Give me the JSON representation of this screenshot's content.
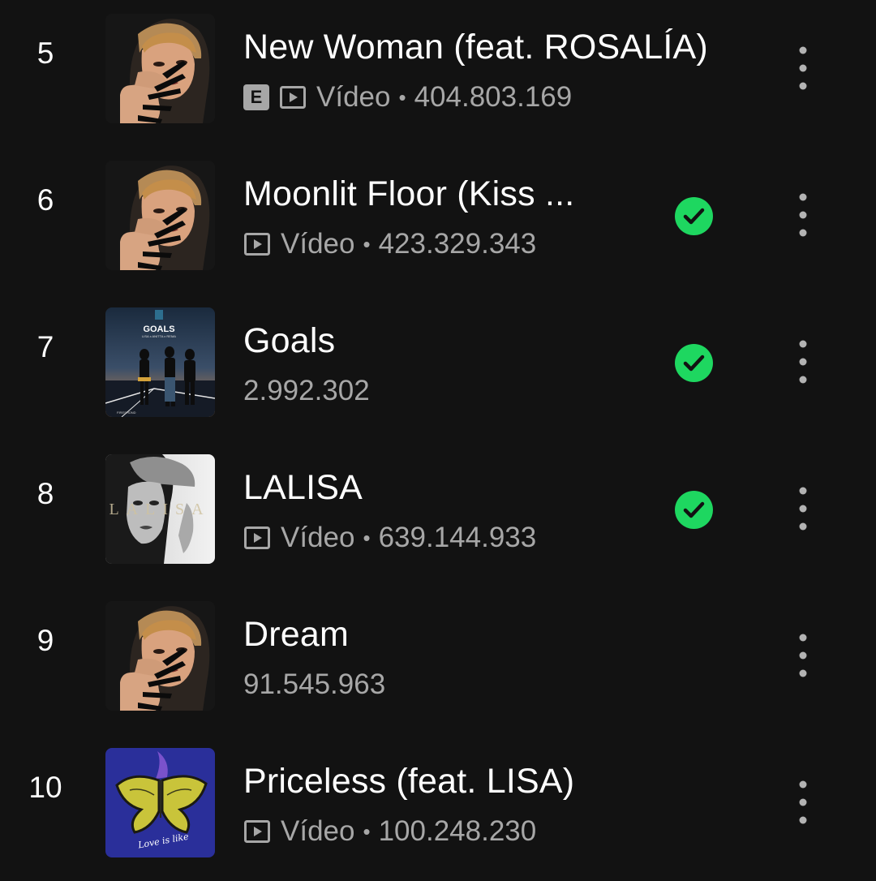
{
  "colors": {
    "background": "#121212",
    "primary_text": "#ffffff",
    "secondary_text": "#a7a7a7",
    "saved_green": "#1ed760"
  },
  "tracks": [
    {
      "rank": "5",
      "title": "New Woman (feat. ROSALÍA)",
      "explicit_label": "E",
      "video_label": "Vídeo",
      "separator": "•",
      "plays": "404.803.169",
      "saved": false,
      "cover": "alter-ego-cover",
      "icons": [
        "explicit-icon",
        "video-icon",
        "more-options-icon"
      ]
    },
    {
      "rank": "6",
      "title": "Moonlit Floor (Kiss ...",
      "video_label": "Vídeo",
      "separator": "•",
      "plays": "423.329.343",
      "saved": true,
      "cover": "alter-ego-cover",
      "icons": [
        "video-icon",
        "check-icon",
        "more-options-icon"
      ]
    },
    {
      "rank": "7",
      "title": "Goals",
      "plays": "2.992.302",
      "saved": true,
      "cover": "goals-cover",
      "cover_text": {
        "title": "GOALS",
        "artists": "LISA x ANITTA x REMA",
        "label": "FIRESHOND"
      },
      "icons": [
        "check-icon",
        "more-options-icon"
      ]
    },
    {
      "rank": "8",
      "title": "LALISA",
      "video_label": "Vídeo",
      "separator": "•",
      "plays": "639.144.933",
      "saved": true,
      "cover": "lalisa-cover",
      "cover_text": {
        "title": "LALISA"
      },
      "icons": [
        "video-icon",
        "check-icon",
        "more-options-icon"
      ]
    },
    {
      "rank": "9",
      "title": "Dream",
      "plays": "91.545.963",
      "saved": false,
      "cover": "alter-ego-cover",
      "icons": [
        "more-options-icon"
      ]
    },
    {
      "rank": "10",
      "title": "Priceless (feat. LISA)",
      "video_label": "Vídeo",
      "separator": "•",
      "plays": "100.248.230",
      "saved": false,
      "cover": "priceless-cover",
      "cover_text": {
        "script": "Love is like"
      },
      "icons": [
        "video-icon",
        "more-options-icon"
      ]
    }
  ]
}
